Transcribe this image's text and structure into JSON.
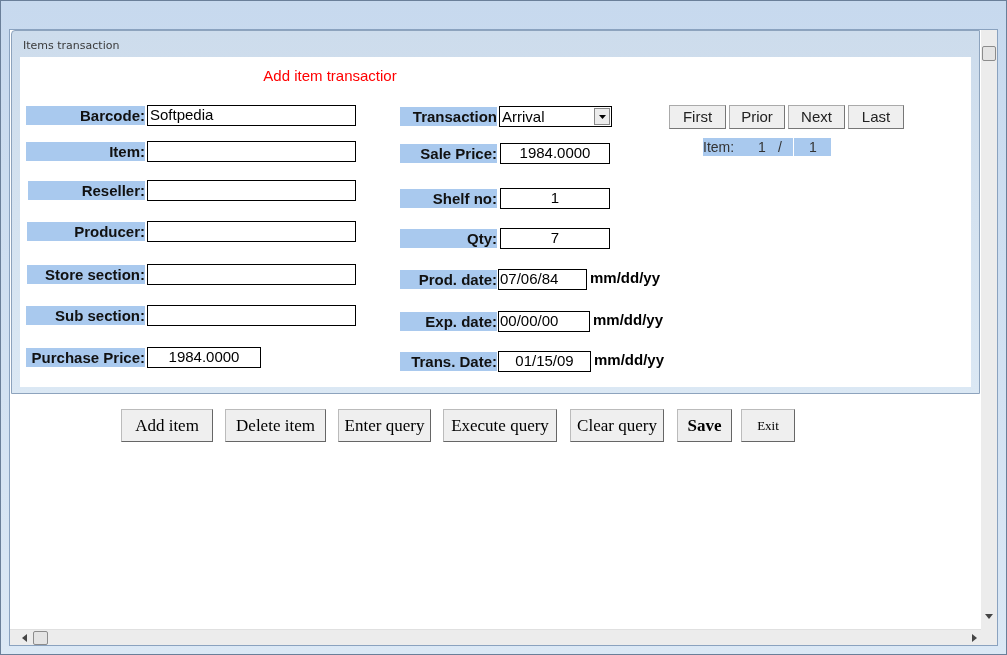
{
  "panel": {
    "title": "Items transaction"
  },
  "heading": "Add item transactior",
  "left_fields": [
    {
      "label": "Barcode:",
      "value": "Softpedia"
    },
    {
      "label": "Item:"
    },
    {
      "label": "Reseller:"
    },
    {
      "label": "Producer:"
    },
    {
      "label": "Store section:"
    },
    {
      "label": "Sub section:"
    },
    {
      "label": "Purchase Price:",
      "value": "1984.0000"
    }
  ],
  "middle_fields": [
    {
      "kind": "dropdown",
      "label": "Transaction",
      "value": "Arrival"
    },
    {
      "kind": "text",
      "label": "Sale Price:",
      "value": "1984.0000"
    },
    {
      "kind": "text",
      "label": "Shelf no:",
      "value": "1"
    },
    {
      "kind": "text",
      "label": "Qty:",
      "value": "7"
    },
    {
      "kind": "date",
      "label": "Prod. date:",
      "value": "07/06/84",
      "hint": "mm/dd/yy"
    },
    {
      "kind": "date",
      "label": "Exp. date:",
      "value": "00/00/00",
      "hint": "mm/dd/yy"
    },
    {
      "kind": "date",
      "label": "Trans. Date:",
      "value": "01/15/09",
      "hint": "mm/dd/yy"
    }
  ],
  "nav_buttons": [
    "First",
    "Prior",
    "Next",
    "Last"
  ],
  "record_counter": {
    "label": "Item:",
    "current": "1",
    "separator": "/",
    "total": "1"
  },
  "action_buttons": [
    {
      "kind": "normal",
      "label": "Add item"
    },
    {
      "kind": "normal",
      "label": "Delete item"
    },
    {
      "kind": "normal",
      "label": "Enter query"
    },
    {
      "kind": "normal",
      "label": "Execute query"
    },
    {
      "kind": "normal",
      "label": "Clear query"
    },
    {
      "kind": "bold",
      "label": "Save"
    },
    {
      "kind": "small",
      "label": "Exit"
    }
  ]
}
